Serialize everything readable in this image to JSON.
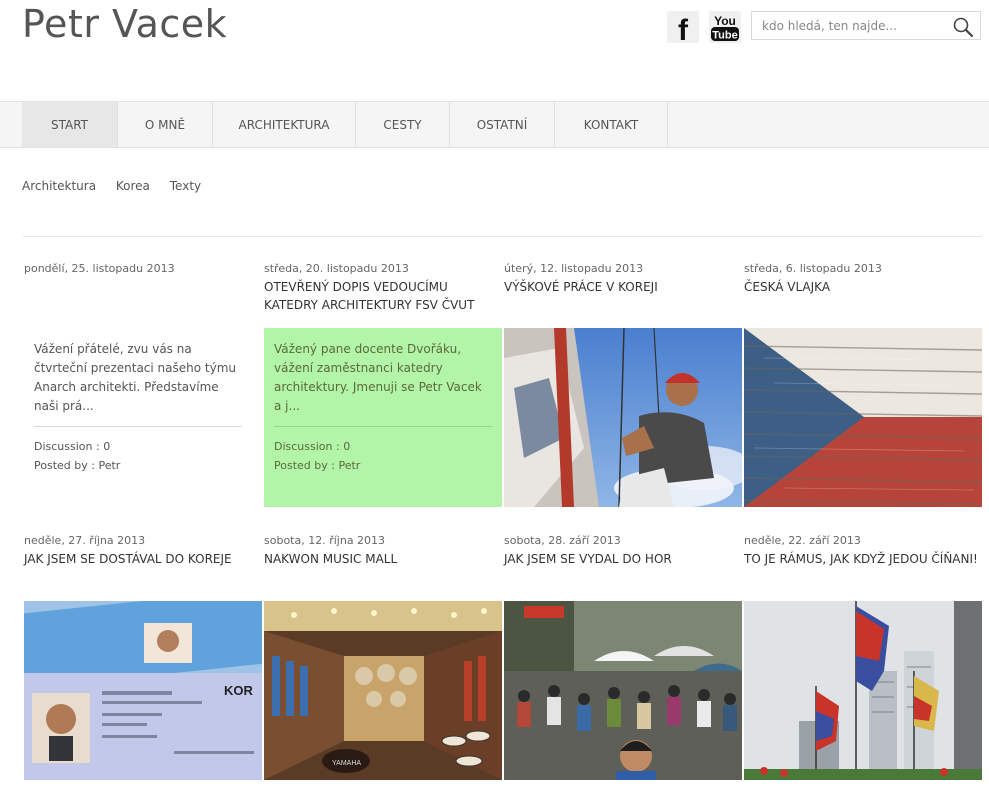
{
  "site": {
    "title": "Petr Vacek"
  },
  "search": {
    "placeholder": "kdo hledá, ten najde..."
  },
  "social": {
    "facebook": "f",
    "youtube_top": "You",
    "youtube_bottom": "Tube"
  },
  "nav": [
    {
      "label": "START",
      "active": true
    },
    {
      "label": "O MNĚ"
    },
    {
      "label": "ARCHITEKTURA"
    },
    {
      "label": "CESTY"
    },
    {
      "label": "OSTATNÍ"
    },
    {
      "label": "KONTAKT"
    }
  ],
  "subnav": [
    "Architektura",
    "Korea",
    "Texty"
  ],
  "posts": [
    {
      "date": "pondělí, 25. listopadu 2013",
      "title": "",
      "excerpt": "Vážení přátelé, zvu vás na čtvrteční prezentaci našeho týmu Anarch architekti. Představíme naši prá...",
      "discussion": "Discussion : 0",
      "author": "Posted by : Petr",
      "thumb": "none"
    },
    {
      "date": "středa, 20. listopadu 2013",
      "title": "OTEVŘENÝ DOPIS VEDOUCÍMU KATEDRY ARCHITEKTURY FSV ČVUT",
      "excerpt": "Vážený pane docente Dvořáku, vážení zaměstnanci katedry architektury. Jmenuji se Petr Vacek a j...",
      "discussion": "Discussion : 0",
      "author": "Posted by : Petr",
      "thumb": "none"
    },
    {
      "date": "úterý, 12. listopadu 2013",
      "title": "VÝŠKOVÉ PRÁCE V KOREJI",
      "thumb": "climber-photo"
    },
    {
      "date": "středa, 6. listopadu 2013",
      "title": "ČESKÁ VLAJKA",
      "thumb": "czech-flag-photo"
    },
    {
      "date": "neděle, 27. října 2013",
      "title": "JAK JSEM SE DOSTÁVAL DO KOREJE",
      "thumb": "id-cards-photo"
    },
    {
      "date": "sobota, 12. října 2013",
      "title": "NAKWON MUSIC MALL",
      "thumb": "music-shop-photo"
    },
    {
      "date": "sobota, 28. září 2013",
      "title": "JAK JSEM SE VYDAL DO HOR",
      "thumb": "crowd-market-photo"
    },
    {
      "date": "neděle, 22. září 2013",
      "title": "TO JE RÁMUS, JAK KDYŽ JEDOU ČÍŇANI!",
      "thumb": "flags-city-photo"
    }
  ],
  "photo_text": {
    "card_brand": "KOR",
    "drum_brand": "YAMAHA"
  },
  "colors": {
    "accent_green": "#b2f4a8",
    "nav_bg": "#f5f5f5"
  }
}
